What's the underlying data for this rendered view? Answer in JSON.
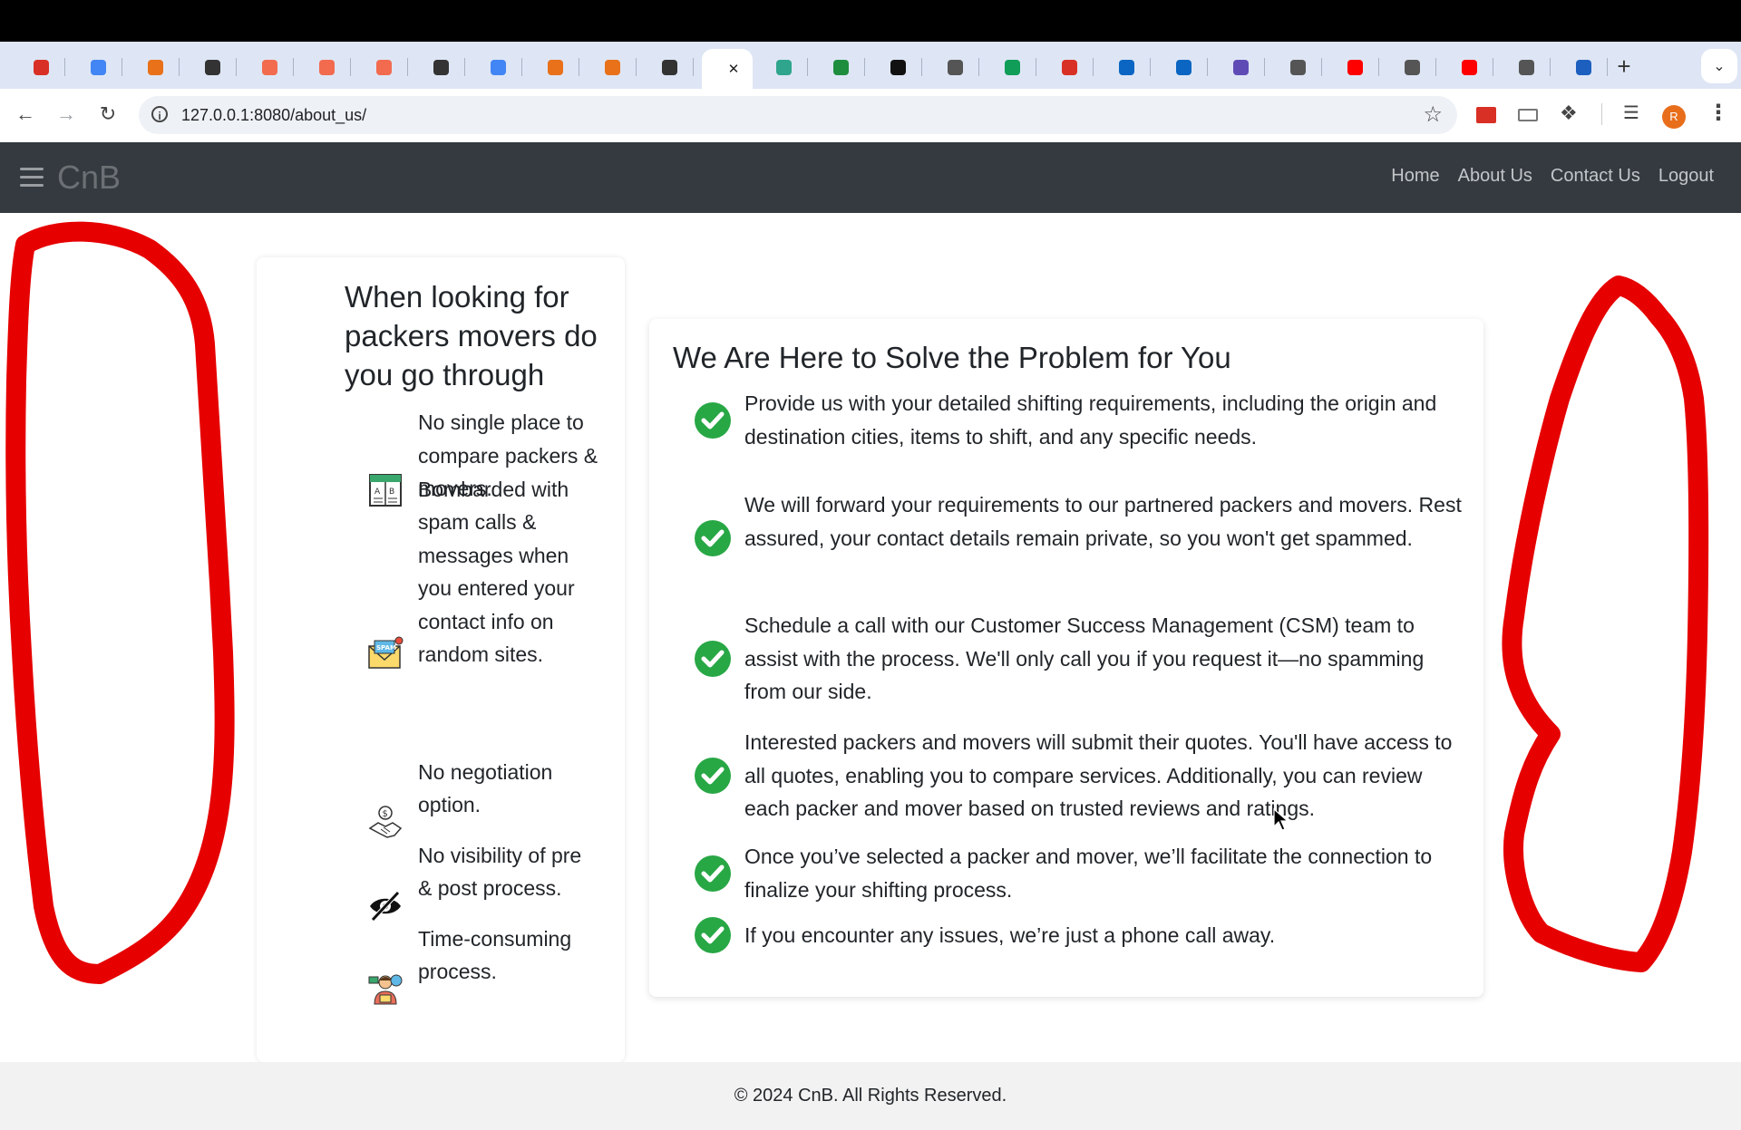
{
  "browser": {
    "tabs": [
      {
        "icon": "gmail-icon",
        "color": "#d93025"
      },
      {
        "icon": "calendar-icon",
        "color": "#4285f4"
      },
      {
        "icon": "loading-icon",
        "color": "#e8711a"
      },
      {
        "icon": "chatgpt-icon",
        "color": "#333333"
      },
      {
        "icon": "app-icon",
        "color": "#f26b4f"
      },
      {
        "icon": "app-icon",
        "color": "#f26b4f"
      },
      {
        "icon": "app-icon",
        "color": "#f26b4f"
      },
      {
        "icon": "chatgpt-icon",
        "color": "#333333"
      },
      {
        "icon": "google-icon",
        "color": "#4285f4"
      },
      {
        "icon": "loading-icon",
        "color": "#e8711a"
      },
      {
        "icon": "loading-icon",
        "color": "#e8711a"
      },
      {
        "icon": "chatgpt-icon",
        "color": "#333333"
      },
      {
        "icon": "active-tab-icon",
        "color": "#888888"
      },
      {
        "icon": "vue-icon",
        "color": "#2ea58c"
      },
      {
        "icon": "meet-icon",
        "color": "#1e8e3e"
      },
      {
        "icon": "diamond-icon",
        "color": "#111111"
      },
      {
        "icon": "globe-icon",
        "color": "#555555"
      },
      {
        "icon": "sheets-icon",
        "color": "#0f9d58"
      },
      {
        "icon": "ext-icon",
        "color": "#d93025"
      },
      {
        "icon": "linkedin-icon",
        "color": "#0a66c2"
      },
      {
        "icon": "linkedin-icon",
        "color": "#0a66c2"
      },
      {
        "icon": "play-icon",
        "color": "#5f4bb6"
      },
      {
        "icon": "globe-icon",
        "color": "#555555"
      },
      {
        "icon": "youtube-icon",
        "color": "#ff0000"
      },
      {
        "icon": "globe-icon",
        "color": "#555555"
      },
      {
        "icon": "youtube-icon",
        "color": "#ff0000"
      },
      {
        "icon": "globe-icon",
        "color": "#555555"
      },
      {
        "icon": "x-icon",
        "color": "#1d5fbf"
      }
    ],
    "new_tab": "+",
    "url": "127.0.0.1:8080/about_us/",
    "profile_initial": "R"
  },
  "navbar": {
    "brand": "CnB",
    "links": [
      "Home",
      "About Us",
      "Contact Us",
      "Logout"
    ]
  },
  "left_card": {
    "title": "When looking for packers movers do you go through",
    "items": [
      {
        "icon": "comparison-icon",
        "text": "No single place to compare packers & movers."
      },
      {
        "icon": "spam-mail-icon",
        "text": "Bombarded with spam calls & messages when you entered your contact info on random sites."
      },
      {
        "icon": "handshake-money-icon",
        "text": "No negotiation option."
      },
      {
        "icon": "eye-slash-icon",
        "text": "No visibility of pre & post process."
      },
      {
        "icon": "time-person-icon",
        "text": "Time-consuming process."
      }
    ]
  },
  "right_card": {
    "title": "We Are Here to Solve the Problem for You",
    "items": [
      "Provide us with your detailed shifting requirements, including the origin and destination cities, items to shift, and any specific needs.",
      "We will forward your requirements to our partnered packers and movers. Rest assured, your contact details remain private, so you won't get spammed.",
      "Schedule a call with our Customer Success Management (CSM) team to assist with the process. We'll only call you if you request it—no spamming from our side.",
      "Interested packers and movers will submit their quotes. You'll have access to all quotes, enabling you to compare services. Additionally, you can review each packer and mover based on trusted reviews and ratings.",
      "Once you’ve selected a packer and mover, we’ll facilitate the connection to finalize your shifting process.",
      "If you encounter any issues, we’re just a phone call away."
    ],
    "check_color": "#28a745"
  },
  "footer": {
    "text": "© 2024 CnB. All Rights Reserved."
  },
  "annotation_color": "#e60000"
}
